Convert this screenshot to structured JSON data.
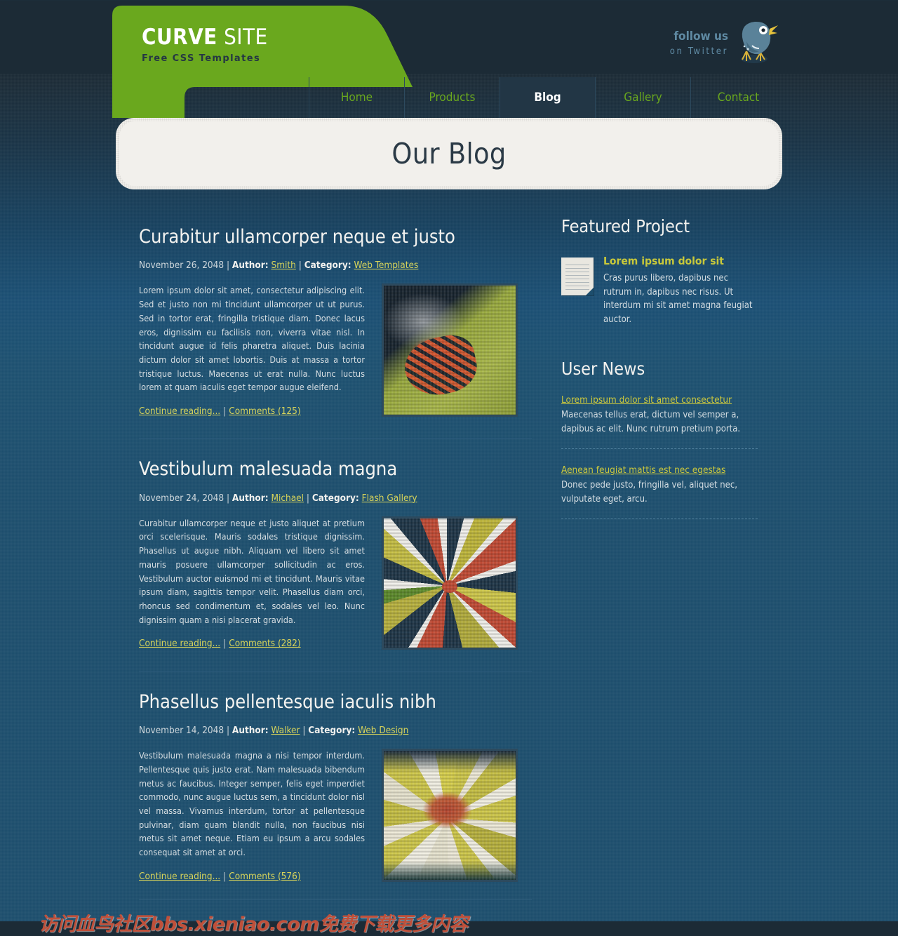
{
  "header": {
    "logo_bold": "CURVE",
    "logo_light": " SITE",
    "logo_tagline": "Free CSS Templates",
    "twitter_line1": "follow us",
    "twitter_line2": "on Twitter"
  },
  "nav": {
    "items": [
      {
        "label": "Home",
        "active": false
      },
      {
        "label": "Products",
        "active": false
      },
      {
        "label": "Blog",
        "active": true
      },
      {
        "label": "Gallery",
        "active": false
      },
      {
        "label": "Contact",
        "active": false
      }
    ]
  },
  "page": {
    "title": "Our Blog"
  },
  "posts": [
    {
      "title": "Curabitur ullamcorper neque et justo",
      "date": "November 26, 2048",
      "author_label": "Author:",
      "author": "Smith",
      "category_label": "Category:",
      "category": "Web Templates",
      "text": "Lorem ipsum dolor sit amet, consectetur adipiscing elit. Sed et justo non mi tincidunt ullamcorper ut ut purus. Sed in tortor erat, fringilla tristique diam. Donec lacus eros, dignissim eu facilisis non, viverra vitae nisl. In tincidunt augue id felis pharetra aliquet. Duis lacinia dictum dolor sit amet lobortis. Duis at massa a tortor tristique luctus. Maecenas ut erat nulla. Nunc luctus lorem at quam iaculis eget tempor augue eleifend.",
      "continue": "Continue reading...",
      "comments": "Comments (125)",
      "thumb_alt": "monarch-butterfly-on-green-leaves"
    },
    {
      "title": "Vestibulum malesuada magna",
      "date": "November 24, 2048",
      "author_label": "Author:",
      "author": "Michael",
      "category_label": "Category:",
      "category": "Flash Gallery",
      "text": "Curabitur ullamcorper neque et justo aliquet at pretium orci scelerisque. Mauris sodales tristique dignissim. Phasellus ut augue nibh. Aliquam vel libero sit amet mauris posuere ullamcorper sollicitudin ac eros. Vestibulum auctor euismod mi et tincidunt. Mauris vitae ipsum diam, sagittis tempor velit. Phasellus diam orci, rhoncus sed condimentum et, sodales vel leo. Nunc dignissim quam a nisi placerat gravida.",
      "continue": "Continue reading...",
      "comments": "Comments (282)",
      "thumb_alt": "colorful-radial-starburst-abstract"
    },
    {
      "title": "Phasellus pellentesque iaculis nibh",
      "date": "November 14, 2048",
      "author_label": "Author:",
      "author": "Walker",
      "category_label": "Category:",
      "category": "Web Design",
      "text": "Vestibulum malesuada magna a nisi tempor interdum. Pellentesque quis justo erat. Nam malesuada bibendum metus ac faucibus. Integer semper, felis eget imperdiet commodo, nunc augue luctus sem, a tincidunt dolor nisl vel massa. Vivamus interdum, tortor at pellentesque pulvinar, diam quam blandit nulla, non faucibus nisi metus sit amet neque. Etiam eu ipsum a arcu sodales consequat sit amet at orci.",
      "continue": "Continue reading...",
      "comments": "Comments (576)",
      "thumb_alt": "yellow-white-water-lily-flower"
    }
  ],
  "sidebar": {
    "featured_heading": "Featured Project",
    "featured": {
      "title": "Lorem ipsum dolor sit",
      "text": "Cras purus libero, dapibus nec rutrum in, dapibus nec risus. Ut interdum mi sit amet magna feugiat auctor."
    },
    "news_heading": "User News",
    "news": [
      {
        "link": "Lorem ipsum dolor sit amet consectetur",
        "text": "Maecenas tellus erat, dictum vel semper a, dapibus ac elit. Nunc rutrum pretium porta."
      },
      {
        "link": "Aenean feugiat mattis est nec egestas",
        "text": "Donec pede justo, fringilla vel, aliquet nec, vulputate eget, arcu."
      }
    ]
  },
  "footer": {
    "watermark": "访问血鸟社区bbs.xieniao.com免费下载更多内容"
  },
  "colors": {
    "accent_green": "#6aa81e",
    "background_dark": "#1c2b36",
    "background_light": "#1d4e6d",
    "link_yellow": "#d8d45a",
    "panel_cream": "#f2f0ec",
    "watermark_red": "#c0503a"
  }
}
